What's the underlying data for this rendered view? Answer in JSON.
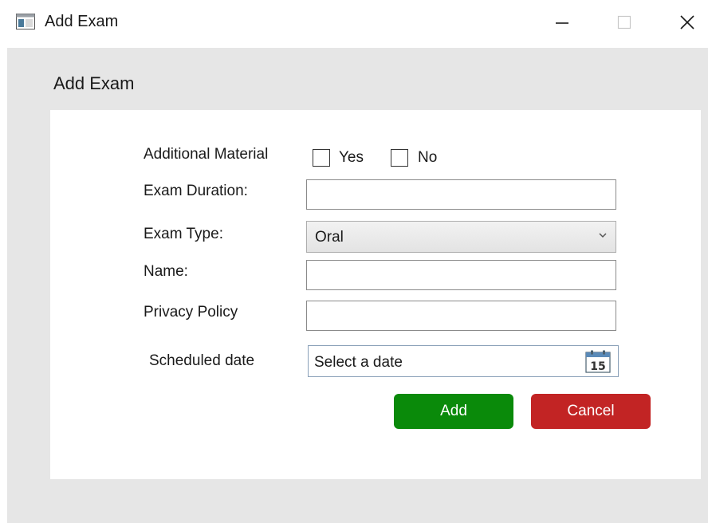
{
  "window": {
    "title": "Add Exam",
    "controls": {
      "minimize_icon": "minimize-icon",
      "maximize_icon": "maximize-icon",
      "close_icon": "close-icon"
    }
  },
  "heading": "Add Exam",
  "form": {
    "additional_material": {
      "label": "Additional Material",
      "options": [
        {
          "label": "Yes",
          "checked": false
        },
        {
          "label": "No",
          "checked": false
        }
      ]
    },
    "exam_duration": {
      "label": "Exam Duration:",
      "value": ""
    },
    "exam_type": {
      "label": "Exam Type:",
      "selected": "Oral"
    },
    "name": {
      "label": "Name:",
      "value": ""
    },
    "privacy_policy": {
      "label": "Privacy Policy",
      "value": ""
    },
    "scheduled_date": {
      "label": "Scheduled date",
      "placeholder": "Select a date",
      "calendar_day": "15"
    }
  },
  "buttons": {
    "add": {
      "label": "Add",
      "color": "#0a8a0a"
    },
    "cancel": {
      "label": "Cancel",
      "color": "#c22424"
    }
  },
  "colors": {
    "client_background": "#e6e6e6",
    "panel_background": "#ffffff"
  }
}
